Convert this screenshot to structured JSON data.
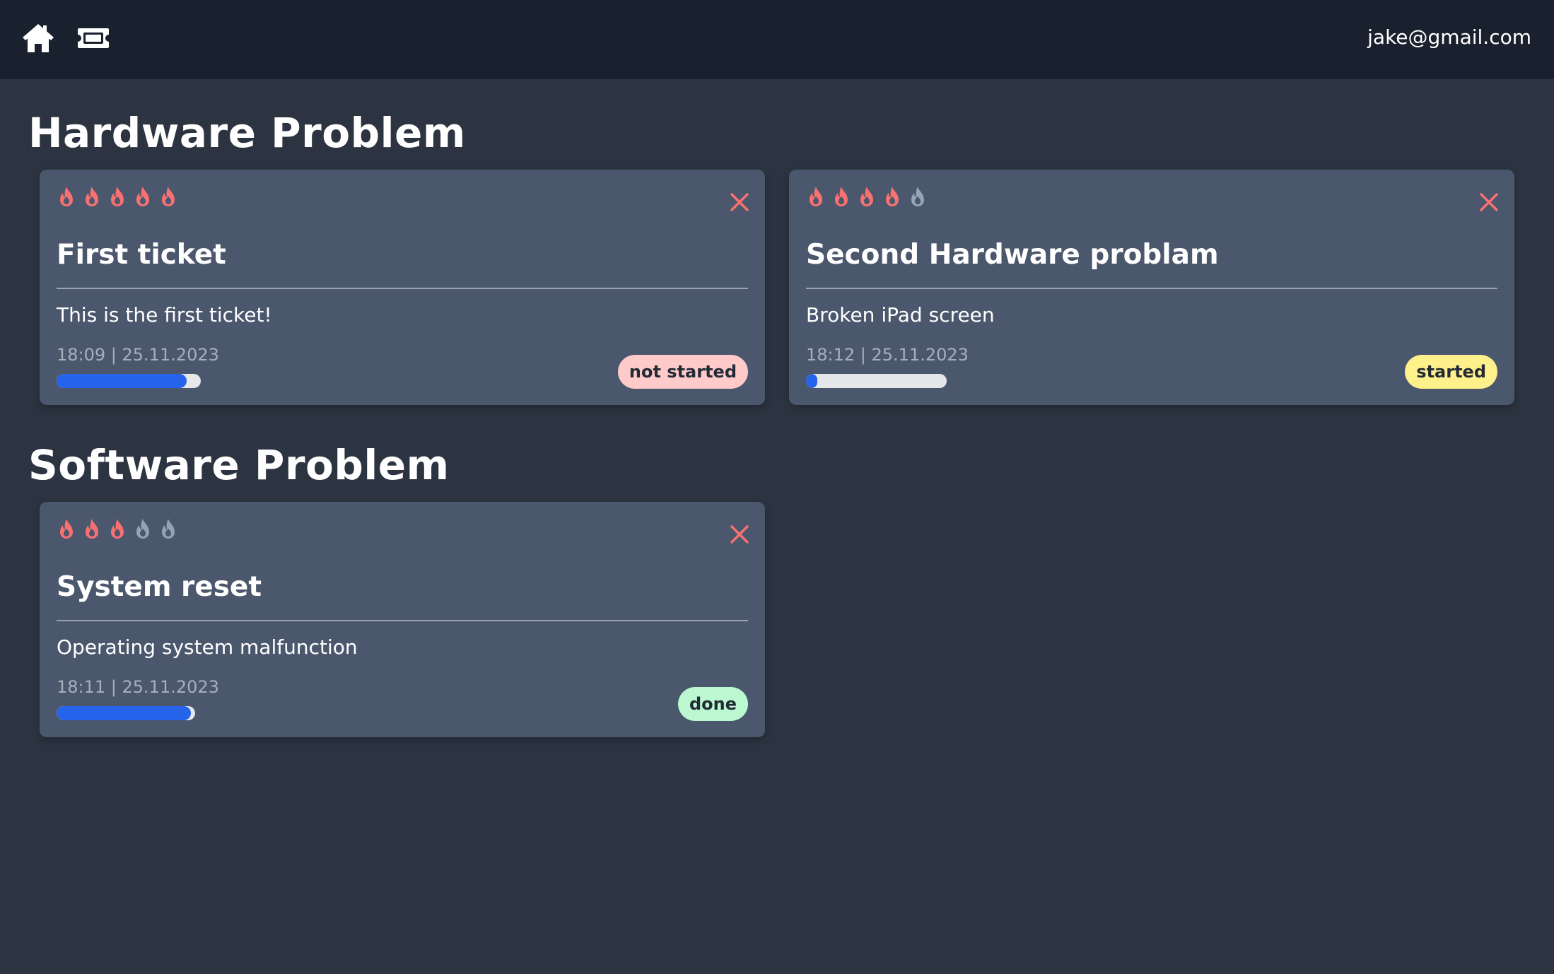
{
  "header": {
    "home_icon": "home-icon",
    "tickets_icon": "ticket-icon",
    "user_email": "jake@gmail.com"
  },
  "colors": {
    "background": "#2c3441",
    "topbar": "#1a212e",
    "card": "#4a576d",
    "flame_active": "#f87171",
    "flame_inactive": "#94a3b8",
    "close": "#f87171",
    "progress_fill": "#2563eb",
    "progress_track": "#e5e7eb"
  },
  "sections": [
    {
      "title": "Hardware Problem",
      "tickets": [
        {
          "priority": 5,
          "priority_max": 5,
          "title": "First ticket",
          "description": "This is the first ticket!",
          "timestamp": "18:09 | 25.11.2023",
          "progress": 0.9,
          "status": "not started",
          "status_color": "#fecaca"
        },
        {
          "priority": 4,
          "priority_max": 5,
          "title": "Second Hardware problam",
          "description": "Broken iPad screen",
          "timestamp": "18:12 | 25.11.2023",
          "progress": 0.08,
          "status": "started",
          "status_color": "#fef08a"
        }
      ]
    },
    {
      "title": "Software Problem",
      "tickets": [
        {
          "priority": 3,
          "priority_max": 5,
          "title": "System reset",
          "description": "Operating system malfunction",
          "timestamp": "18:11 | 25.11.2023",
          "progress": 0.97,
          "status": "done",
          "status_color": "#bbf7d0"
        }
      ]
    }
  ]
}
